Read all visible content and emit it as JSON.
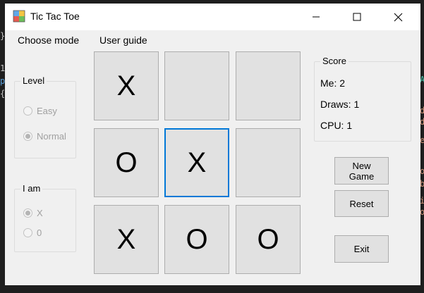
{
  "window": {
    "title": "Tic Tac Toe"
  },
  "menu": {
    "choose_mode": "Choose mode",
    "user_guide": "User guide"
  },
  "level": {
    "label": "Level",
    "easy": "Easy",
    "normal": "Normal",
    "selected": "Normal"
  },
  "iam": {
    "label": "I am",
    "x": "X",
    "o": "0",
    "selected": "X"
  },
  "board": {
    "cells": [
      "X",
      "",
      "",
      "O",
      "X",
      "",
      "X",
      "O",
      "O"
    ],
    "focused_index": 4
  },
  "score": {
    "label": "Score",
    "me": "Me: 2",
    "draws": "Draws: 1",
    "cpu": "CPU: 1"
  },
  "buttons": {
    "new_game_line1": "New",
    "new_game_line2": "Game",
    "reset": "Reset",
    "exit": "Exit"
  },
  "colors": {
    "focus": "#0078d7",
    "background_editor": "#1e1e1e"
  }
}
